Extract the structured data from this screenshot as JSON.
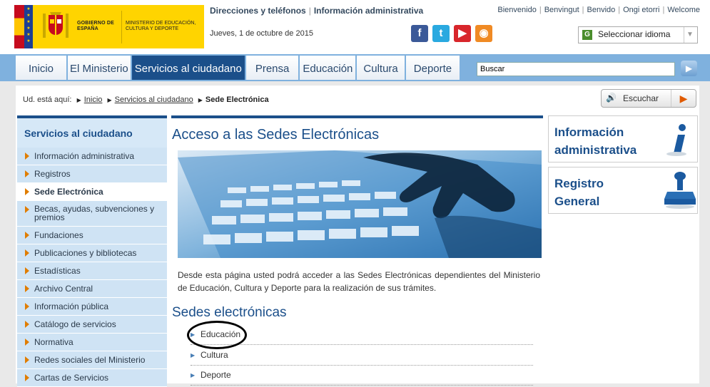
{
  "header": {
    "logo_gob": "GOBIERNO DE ESPAÑA",
    "logo_min": "MINISTERIO DE EDUCACIÓN, CULTURA Y DEPORTE",
    "link_directorio": "Direcciones y teléfonos",
    "link_info": "Información administrativa",
    "date": "Jueves, 1 de octubre de 2015",
    "languages": [
      "Bienvenido",
      "Benvingut",
      "Benvido",
      "Ongi etorri",
      "Welcome"
    ],
    "language_select": "Seleccionar idioma"
  },
  "nav": {
    "tabs": [
      "Inicio",
      "El Ministerio",
      "Servicios al ciudadano",
      "Prensa",
      "Educación",
      "Cultura",
      "Deporte"
    ],
    "search_value": "Buscar"
  },
  "breadcrumb": {
    "prefix": "Ud. está aquí:",
    "items": [
      "Inicio",
      "Servicios al ciudadano"
    ],
    "current": "Sede Electrónica"
  },
  "escuchar": "Escuchar",
  "sidebar": {
    "title": "Servicios al ciudadano",
    "items": [
      "Información administrativa",
      "Registros",
      "Sede Electrónica",
      "Becas, ayudas, subvenciones y premios",
      "Fundaciones",
      "Publicaciones y bibliotecas",
      "Estadísticas",
      "Archivo Central",
      "Información pública",
      "Catálogo de servicios",
      "Normativa",
      "Redes sociales del Ministerio",
      "Cartas de Servicios"
    ]
  },
  "main": {
    "title": "Acceso a las Sedes Electrónicas",
    "intro": "Desde esta página usted podrá acceder a las Sedes Electrónicas dependientes del Ministerio de Educación, Cultura y Deporte para la realización de sus trámites.",
    "subtitle": "Sedes electrónicas",
    "sedes": [
      "Educación",
      "Cultura",
      "Deporte"
    ]
  },
  "right": {
    "box1": [
      "Información",
      "administrativa"
    ],
    "box2": [
      "Registro",
      "General"
    ]
  }
}
